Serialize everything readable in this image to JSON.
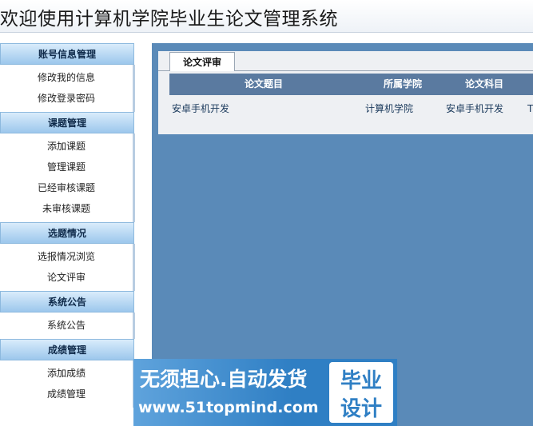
{
  "header": {
    "title": "欢迎使用计算机学院毕业生论文管理系统"
  },
  "sidebar": {
    "sections": [
      {
        "title": "账号信息管理",
        "items": [
          "修改我的信息",
          "修改登录密码"
        ]
      },
      {
        "title": "课题管理",
        "items": [
          "添加课题",
          "管理课题",
          "已经审核课题",
          "未审核课题"
        ]
      },
      {
        "title": "选题情况",
        "items": [
          "选报情况浏览",
          "论文评审"
        ]
      },
      {
        "title": "系统公告",
        "items": [
          "系统公告"
        ]
      },
      {
        "title": "成绩管理",
        "items": [
          "添加成绩",
          "成绩管理"
        ]
      }
    ]
  },
  "main": {
    "tab": "论文评审",
    "columns": [
      "论文题目",
      "所属学院",
      "论文科目"
    ],
    "row": {
      "title": "安卓手机开发",
      "college": "计算机学院",
      "subject": "安卓手机开发",
      "extra": "T"
    }
  },
  "banner": {
    "slogan": "无须担心.自动发货",
    "url": "www.51topmind.com",
    "badge_line1": "毕业",
    "badge_line2": "设计"
  },
  "colors": {
    "content_bg": "#5a8ab8",
    "table_header": "#5a7aa0",
    "section_head": "#9cc7ec"
  }
}
